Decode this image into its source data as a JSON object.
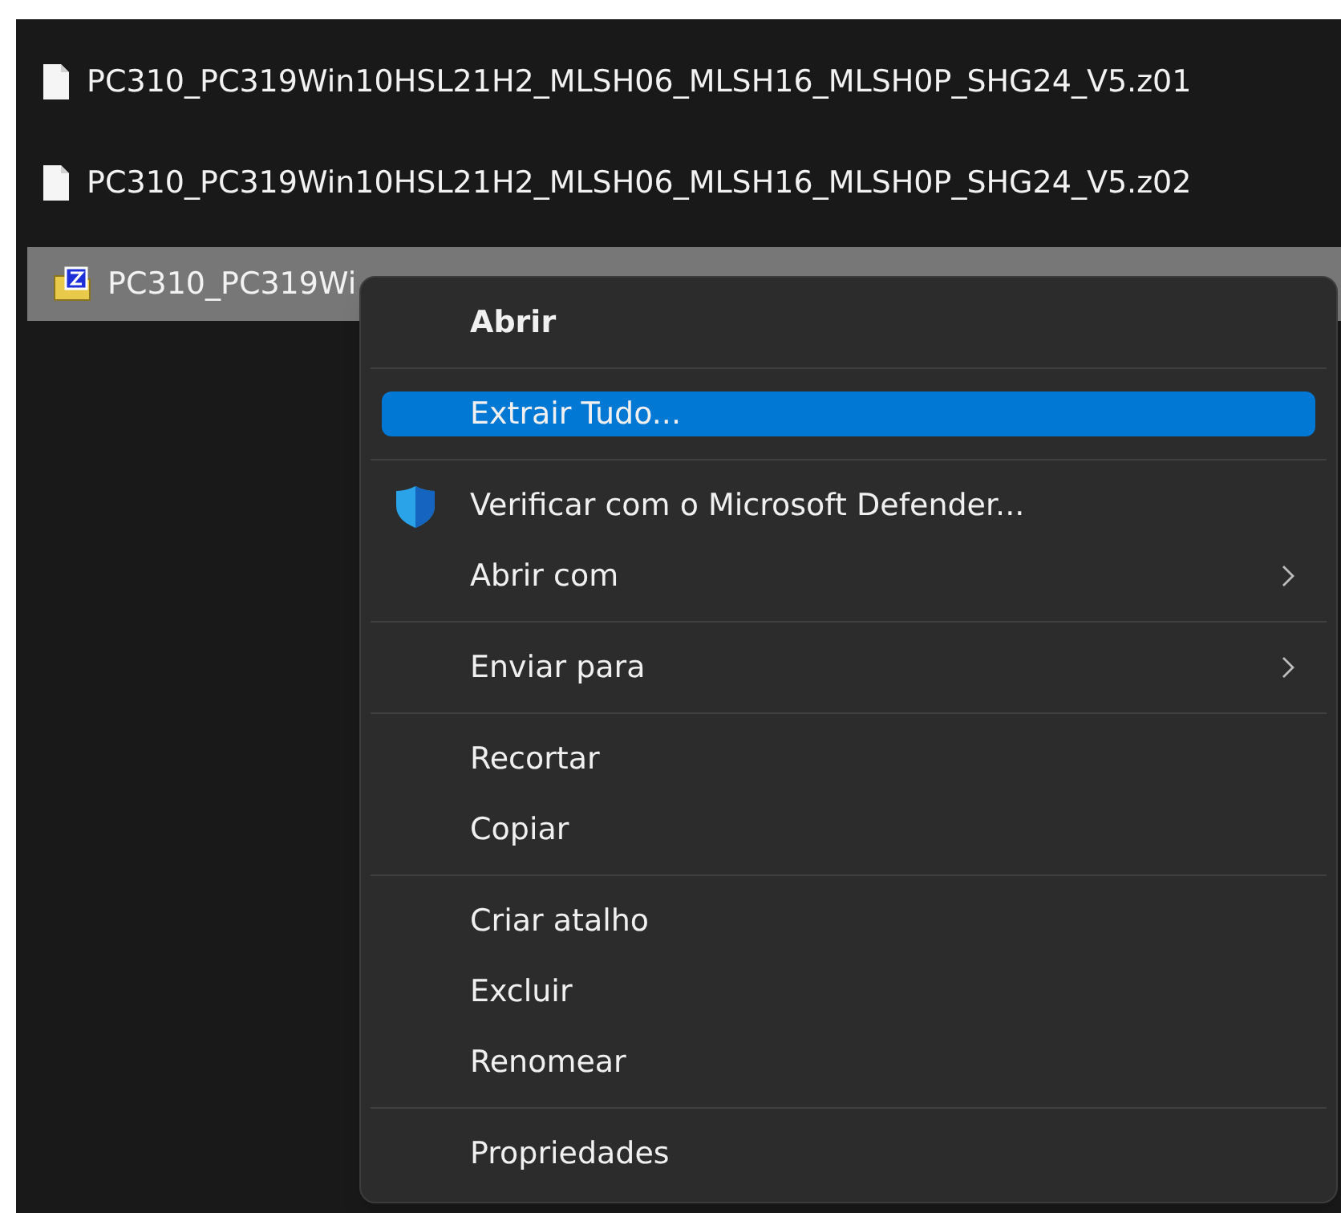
{
  "files": [
    {
      "name": "PC310_PC319Win10HSL21H2_MLSH06_MLSH16_MLSH0P_SHG24_V5.z01",
      "kind": "file",
      "selected": false
    },
    {
      "name": "PC310_PC319Win10HSL21H2_MLSH06_MLSH16_MLSH0P_SHG24_V5.z02",
      "kind": "file",
      "selected": false
    },
    {
      "name": "PC310_PC319Wi",
      "kind": "zip",
      "selected": true
    }
  ],
  "context_menu": {
    "items": [
      {
        "kind": "item",
        "label": "Abrir",
        "default": true,
        "selected": false,
        "submenu": false
      },
      {
        "kind": "separator"
      },
      {
        "kind": "item",
        "label": "Extrair Tudo...",
        "default": false,
        "selected": true,
        "submenu": false
      },
      {
        "kind": "separator"
      },
      {
        "kind": "shield-item",
        "label": "Verificar com o Microsoft Defender...",
        "default": false,
        "selected": false,
        "submenu": false
      },
      {
        "kind": "item",
        "label": "Abrir com",
        "default": false,
        "selected": false,
        "submenu": true
      },
      {
        "kind": "separator"
      },
      {
        "kind": "item",
        "label": "Enviar para",
        "default": false,
        "selected": false,
        "submenu": true
      },
      {
        "kind": "separator"
      },
      {
        "kind": "item",
        "label": "Recortar",
        "default": false,
        "selected": false,
        "submenu": false
      },
      {
        "kind": "item",
        "label": "Copiar",
        "default": false,
        "selected": false,
        "submenu": false
      },
      {
        "kind": "separator"
      },
      {
        "kind": "item",
        "label": "Criar atalho",
        "default": false,
        "selected": false,
        "submenu": false
      },
      {
        "kind": "item",
        "label": "Excluir",
        "default": false,
        "selected": false,
        "submenu": false
      },
      {
        "kind": "item",
        "label": "Renomear",
        "default": false,
        "selected": false,
        "submenu": false
      },
      {
        "kind": "separator"
      },
      {
        "kind": "item",
        "label": "Propriedades",
        "default": false,
        "selected": false,
        "submenu": false
      }
    ]
  }
}
